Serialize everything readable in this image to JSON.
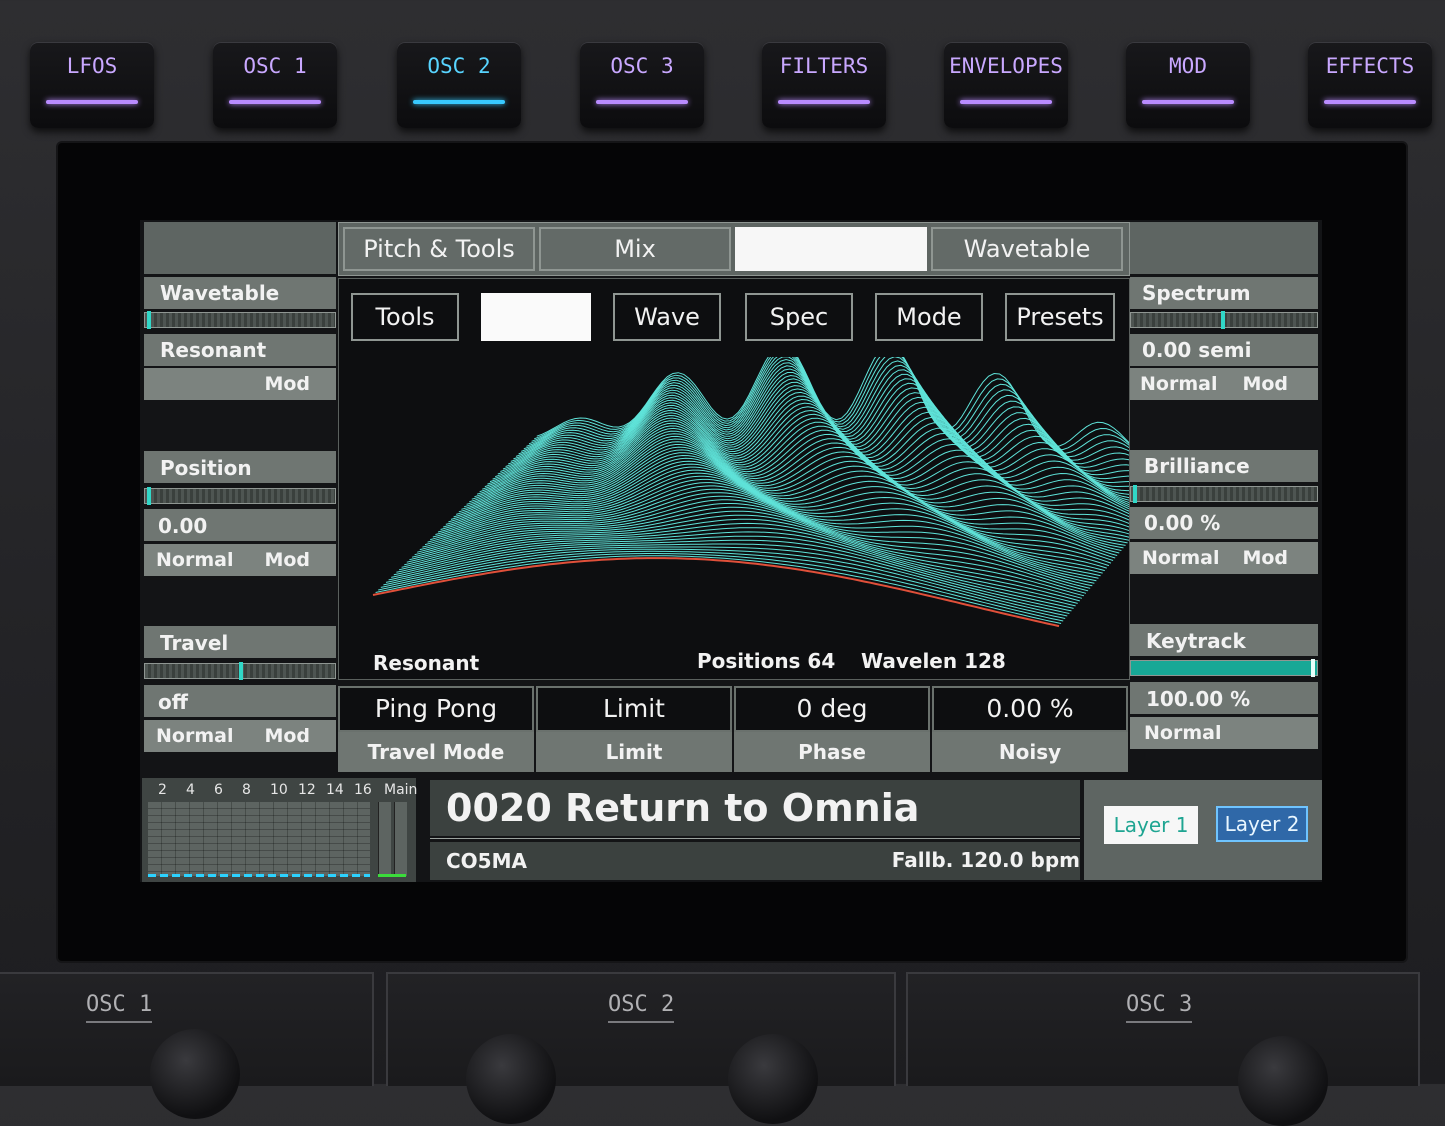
{
  "hardware_buttons": [
    {
      "label": "LFOS",
      "active": false
    },
    {
      "label": "OSC 1",
      "active": false
    },
    {
      "label": "OSC 2",
      "active": true
    },
    {
      "label": "OSC 3",
      "active": false
    },
    {
      "label": "FILTERS",
      "active": false
    },
    {
      "label": "ENVELOPES",
      "active": false
    },
    {
      "label": "MOD",
      "active": false
    },
    {
      "label": "EFFECTS",
      "active": false
    }
  ],
  "top_tabs": {
    "pitch_tools": "Pitch & Tools",
    "mix": "Mix",
    "blank": "",
    "wavetable": "Wavetable"
  },
  "sub_tabs": {
    "tools": "Tools",
    "blank": "",
    "wave": "Wave",
    "spec": "Spec",
    "mode": "Mode",
    "presets": "Presets"
  },
  "left": {
    "wavetable": {
      "label": "Wavetable",
      "value": "Resonant",
      "mod": "Mod",
      "slider_fraction": 0.0
    },
    "position": {
      "label": "Position",
      "value": "0.00",
      "normal": "Normal",
      "mod": "Mod",
      "slider_fraction": 0.0
    },
    "travel": {
      "label": "Travel",
      "value": "off",
      "normal": "Normal",
      "mod": "Mod",
      "slider_fraction": 0.5
    }
  },
  "right": {
    "spectrum": {
      "label": "Spectrum",
      "value": "0.00 semi",
      "normal": "Normal",
      "mod": "Mod",
      "slider_fraction": 0.5
    },
    "brilliance": {
      "label": "Brilliance",
      "value": "0.00 %",
      "normal": "Normal",
      "mod": "Mod",
      "slider_fraction": 0.0
    },
    "keytrack": {
      "label": "Keytrack",
      "value": "100.00 %",
      "normal": "Normal",
      "slider_fraction": 1.0
    }
  },
  "display": {
    "wavetable_name": "Resonant",
    "positions": "Positions 64",
    "wavelen": "Wavelen 128"
  },
  "params": [
    {
      "value": "Ping Pong",
      "label": "Travel Mode"
    },
    {
      "value": "Limit",
      "label": "Limit"
    },
    {
      "value": "0 deg",
      "label": "Phase"
    },
    {
      "value": "0.00 %",
      "label": "Noisy"
    }
  ],
  "meter": {
    "ticks": [
      "2",
      "4",
      "6",
      "8",
      "10",
      "12",
      "14",
      "16",
      "Main"
    ]
  },
  "preset": {
    "name": "0020 Return to Omnia",
    "author": "CO5MA",
    "tempo": "Fallb. 120.0 bpm"
  },
  "layers": {
    "layer1": "Layer 1",
    "layer2": "Layer 2"
  },
  "bottom_panels": [
    "OSC 1",
    "OSC 2",
    "OSC 3"
  ],
  "colors": {
    "accent_purple": "#b98bff",
    "accent_cyan": "#38c9ff",
    "wave": "#5fe3d9",
    "wave_front": "#e0503a",
    "teal": "#1fb7a5"
  }
}
